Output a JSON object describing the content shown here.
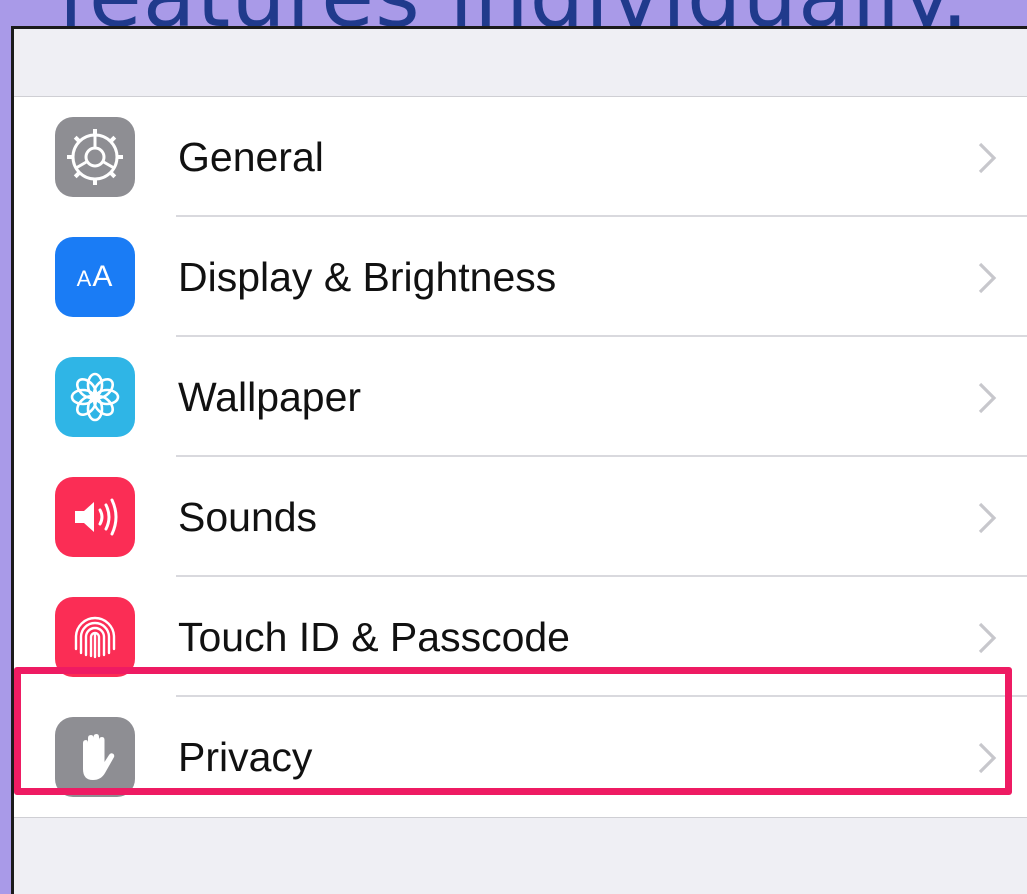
{
  "caption": {
    "text": "features individually."
  },
  "settings": {
    "items": [
      {
        "label": "General",
        "icon": "gear-icon",
        "color": "#8e8e93"
      },
      {
        "label": "Display & Brightness",
        "icon": "text-size-icon",
        "color": "#1a7cf5"
      },
      {
        "label": "Wallpaper",
        "icon": "flower-icon",
        "color": "#2fb5e6"
      },
      {
        "label": "Sounds",
        "icon": "speaker-icon",
        "color": "#fb2d55"
      },
      {
        "label": "Touch ID & Passcode",
        "icon": "fingerprint-icon",
        "color": "#fb2d55"
      },
      {
        "label": "Privacy",
        "icon": "hand-icon",
        "color": "#8e8e93"
      }
    ],
    "icon_glyphs": {
      "display": "AA"
    }
  },
  "highlight": {
    "target": "Privacy",
    "color": "#ee1b63"
  }
}
